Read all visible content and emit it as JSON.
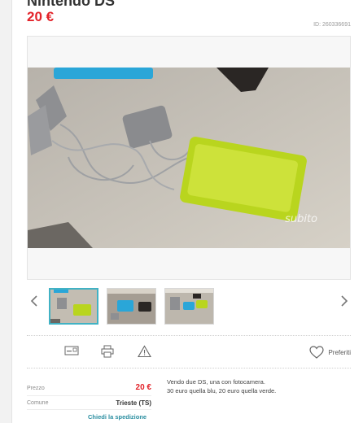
{
  "listing": {
    "title": "Nintendo DS",
    "price": "20 €",
    "ad_id": "ID: 260336691",
    "watermark": "subito"
  },
  "gallery": {
    "prev_icon": "chevron-left-icon",
    "next_icon": "chevron-right-icon",
    "thumbnail_count": 3,
    "active_index": 0
  },
  "actions": {
    "icons": [
      "card-icon",
      "print-icon",
      "warning-icon"
    ],
    "favorite_label": "Preferiti",
    "favorite_icon": "heart-outline-icon"
  },
  "details": {
    "price_label": "Prezzo",
    "price_value": "20 €",
    "comune_label": "Comune",
    "comune_value": "Trieste (TS)",
    "shipping_link": "Chiedi la spedizione"
  },
  "description": {
    "line1": "Vendo due DS, una con fotocamera.",
    "line2": "30 euro quella blu, 20 euro quella verde."
  },
  "colors": {
    "price_red": "#e3232a",
    "accent_teal": "#41b2c4",
    "link_teal": "#2a8ea0"
  }
}
